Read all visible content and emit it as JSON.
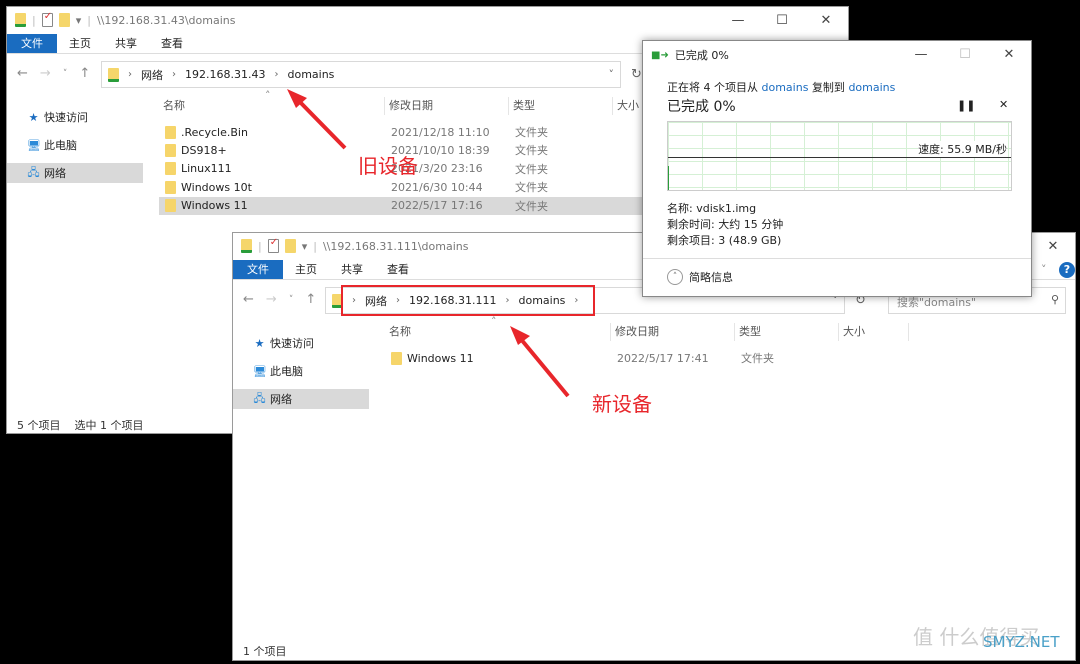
{
  "old_window": {
    "title": "\\\\192.168.31.43\\domains",
    "ribbon_tabs": [
      "文件",
      "主页",
      "共享",
      "查看"
    ],
    "breadcrumb": [
      "网络",
      "192.168.31.43",
      "domains"
    ],
    "columns": [
      "名称",
      "修改日期",
      "类型",
      "大小"
    ],
    "files": [
      {
        "name": ".Recycle.Bin",
        "date": "2021/12/18 11:10",
        "type": "文件夹"
      },
      {
        "name": "DS918+",
        "date": "2021/10/10 18:39",
        "type": "文件夹"
      },
      {
        "name": "Linux111",
        "date": "2021/3/20 23:16",
        "type": "文件夹"
      },
      {
        "name": "Windows 10t",
        "date": "2021/6/30 10:44",
        "type": "文件夹"
      },
      {
        "name": "Windows 11",
        "date": "2022/5/17 17:16",
        "type": "文件夹",
        "selected": true
      }
    ],
    "sidebar": [
      "快速访问",
      "此电脑",
      "网络"
    ],
    "status_count": "5 个项目",
    "status_selected": "选中 1 个项目"
  },
  "new_window": {
    "title": "\\\\192.168.31.111\\domains",
    "ribbon_tabs": [
      "文件",
      "主页",
      "共享",
      "查看"
    ],
    "breadcrumb": [
      "网络",
      "192.168.31.111",
      "domains"
    ],
    "search_placeholder": "搜索\"domains\"",
    "columns": [
      "名称",
      "修改日期",
      "类型",
      "大小"
    ],
    "files": [
      {
        "name": "Windows 11",
        "date": "2022/5/17 17:41",
        "type": "文件夹"
      }
    ],
    "sidebar": [
      "快速访问",
      "此电脑",
      "网络"
    ],
    "status_count": "1 个项目"
  },
  "copy_dialog": {
    "title": "已完成 0%",
    "desc_prefix": "正在将 4 个项目从",
    "source": "domains",
    "desc_mid": "复制到",
    "dest": "domains",
    "progress_label": "已完成 0%",
    "progress_percent": 0,
    "speed": "速度: 55.9 MB/秒",
    "name": "名称: vdisk1.img",
    "time_left": "剩余时间: 大约 15 分钟",
    "items_left": "剩余项目: 3 (48.9 GB)",
    "less_details": "简略信息",
    "accent": "#1a6cc0"
  },
  "annotations": {
    "old": "旧设备",
    "new": "新设备",
    "color": "#e8262b"
  },
  "watermark": "值 什么值得买 SMYZ.NET"
}
